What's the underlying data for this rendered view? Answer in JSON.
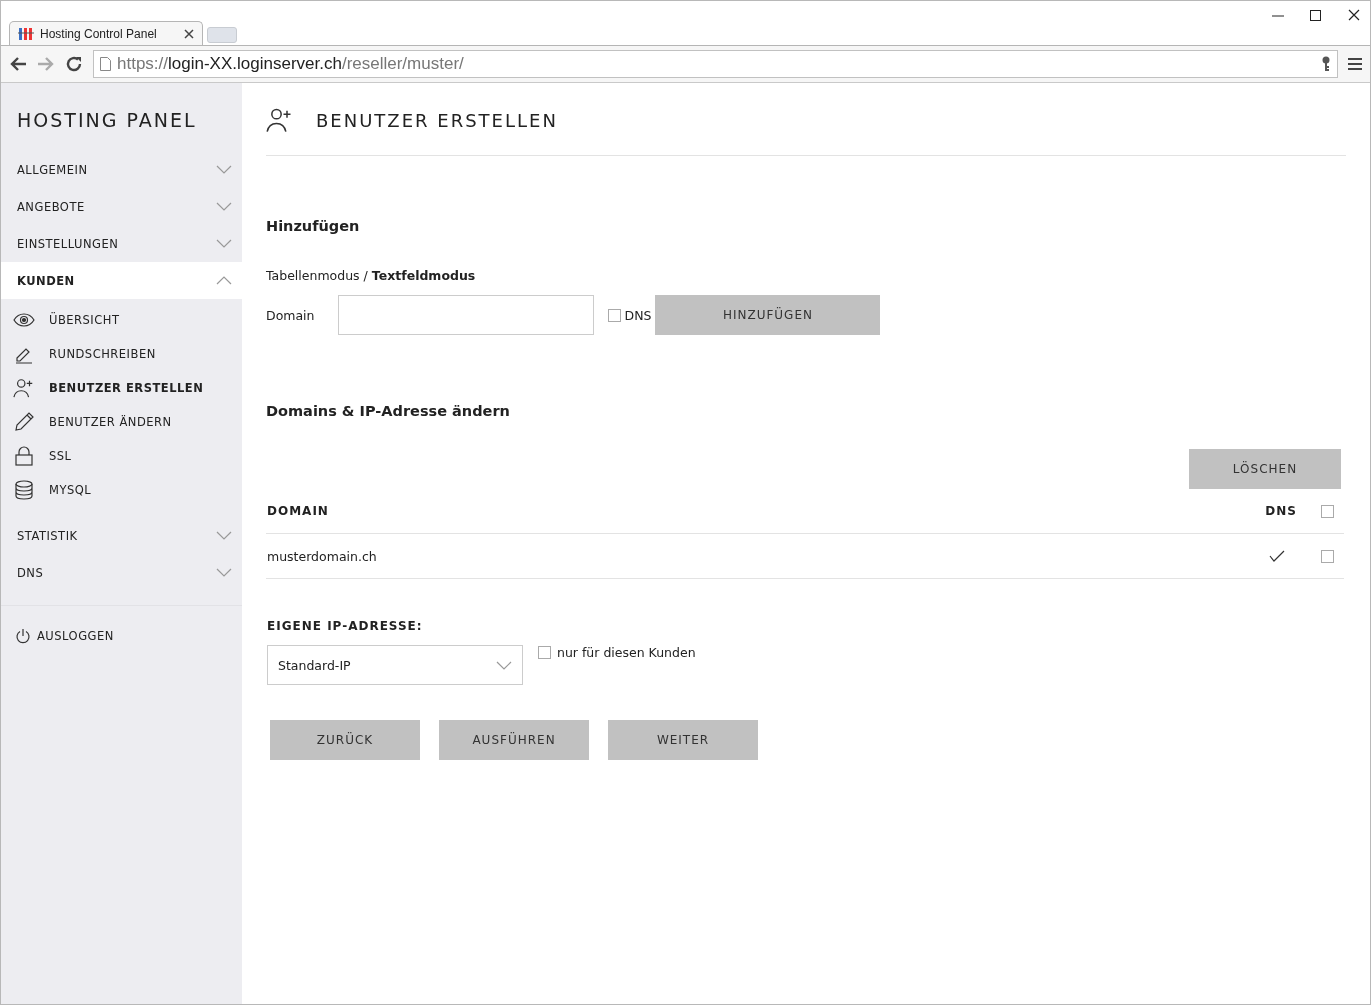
{
  "browser": {
    "tab_title": "Hosting Control Panel",
    "url": {
      "scheme": "https://",
      "host": "login-XX.loginserver.ch",
      "path": "/reseller/muster/"
    }
  },
  "sidebar": {
    "title": "HOSTING PANEL",
    "sections": [
      {
        "label": "ALLGEMEIN",
        "expanded": false
      },
      {
        "label": "ANGEBOTE",
        "expanded": false
      },
      {
        "label": "EINSTELLUNGEN",
        "expanded": false
      },
      {
        "label": "KUNDEN",
        "expanded": true,
        "children": [
          {
            "label": "ÜBERSICHT",
            "selected": false
          },
          {
            "label": "RUNDSCHREIBEN",
            "selected": false
          },
          {
            "label": "BENUTZER ERSTELLEN",
            "selected": true
          },
          {
            "label": "BENUTZER ÄNDERN",
            "selected": false
          },
          {
            "label": "SSL",
            "selected": false
          },
          {
            "label": "MYSQL",
            "selected": false
          }
        ]
      },
      {
        "label": "STATISTIK",
        "expanded": false
      },
      {
        "label": "DNS",
        "expanded": false
      }
    ],
    "logout": "AUSLOGGEN"
  },
  "page": {
    "title": "BENUTZER ERSTELLEN",
    "add": {
      "heading": "Hinzufügen",
      "modes": [
        {
          "label": "Tabellenmodus",
          "selected": false
        },
        {
          "label": "Textfeldmodus",
          "selected": true
        }
      ],
      "mode_separator": "/",
      "domain_label": "Domain",
      "dns": {
        "label": "DNS",
        "checked": false
      },
      "button": "HINZUFÜGEN"
    },
    "edit": {
      "heading": "Domains & IP-Adresse ändern",
      "delete_button": "LÖSCHEN",
      "table": {
        "columns": [
          "DOMAIN",
          "DNS"
        ],
        "select_all": {
          "checked": false
        },
        "rows": [
          {
            "domain": "musterdomain.ch",
            "dns": true,
            "selected": false
          }
        ]
      }
    },
    "ip": {
      "label": "EIGENE IP-ADRESSE:",
      "value": "Standard-IP",
      "only_customer": {
        "label": "nur für diesen Kunden",
        "checked": false
      }
    },
    "buttons": [
      "ZURÜCK",
      "AUSFÜHREN",
      "WEITER"
    ]
  }
}
